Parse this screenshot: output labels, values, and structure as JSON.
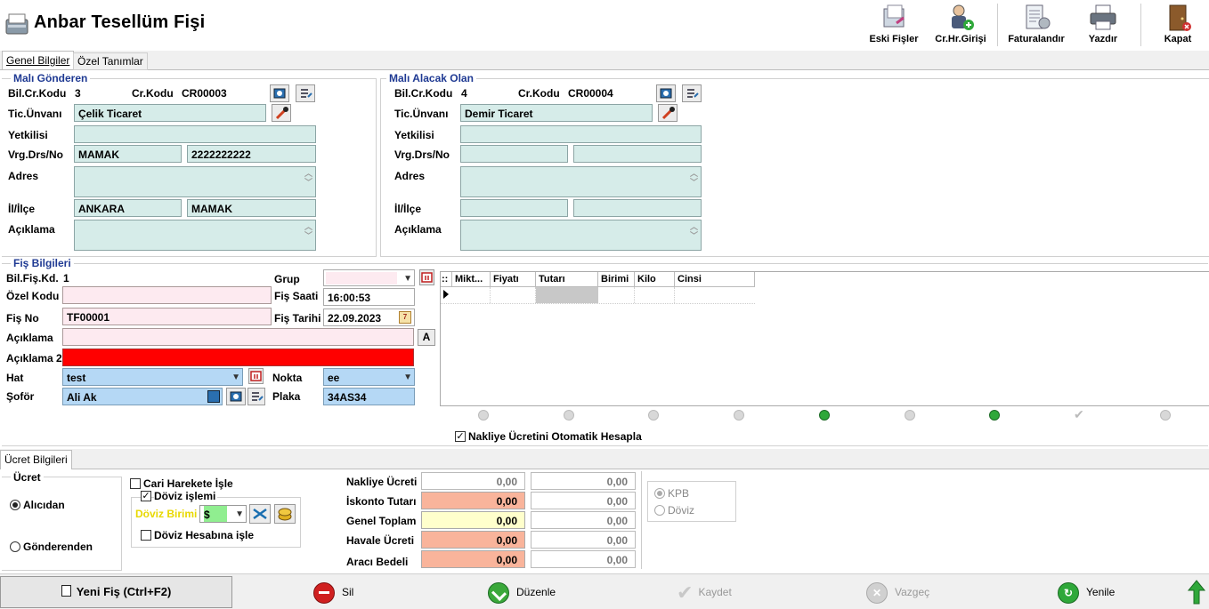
{
  "window": {
    "title": "Anbar Tesellüm Fişi"
  },
  "toolbar": {
    "eski_fisler": "Eski Fişler",
    "cr_hr_girisi": "Cr.Hr.Girişi",
    "faturalandir": "Faturalandır",
    "yazdir": "Yazdır",
    "kapat": "Kapat"
  },
  "tabs": {
    "genel": "Genel Bilgiler",
    "ozel": "Özel Tanımlar"
  },
  "sender": {
    "group_title": "Malı Gönderen",
    "bil_cr_kodu_label": "Bil.Cr.Kodu",
    "bil_cr_kodu": "3",
    "cr_kodu_label": "Cr.Kodu",
    "cr_kodu": "CR00003",
    "tic_unvani_label": "Tic.Ünvanı",
    "tic_unvani": "Çelik Ticaret",
    "yetkilisi_label": "Yetkilisi",
    "yetkilisi": "",
    "vrg_label": "Vrg.Drs/No",
    "vergi_dairesi": "MAMAK",
    "vergi_no": "2222222222",
    "adres_label": "Adres",
    "adres": "",
    "il_ilce_label": "İl/İlçe",
    "il": "ANKARA",
    "ilce": "MAMAK",
    "aciklama_label": "Açıklama",
    "aciklama": ""
  },
  "receiver": {
    "group_title": "Malı Alacak Olan",
    "bil_cr_kodu_label": "Bil.Cr.Kodu",
    "bil_cr_kodu": "4",
    "cr_kodu_label": "Cr.Kodu",
    "cr_kodu": "CR00004",
    "tic_unvani_label": "Tic.Ünvanı",
    "tic_unvani": "Demir Ticaret",
    "yetkilisi_label": "Yetkilisi",
    "yetkilisi": "",
    "vrg_label": "Vrg.Drs/No",
    "vergi_dairesi": "",
    "vergi_no": "",
    "adres_label": "Adres",
    "adres": "",
    "il_ilce_label": "İl/İlçe",
    "il": "",
    "ilce": "",
    "aciklama_label": "Açıklama",
    "aciklama": ""
  },
  "fis": {
    "group_title": "Fiş Bilgileri",
    "bil_fis_kd_label": "Bil.Fiş.Kd.",
    "bil_fis_kd": "1",
    "grup_label": "Grup",
    "grup": "",
    "ozel_kodu_label": "Özel Kodu",
    "ozel_kodu": "",
    "fis_saati_label": "Fiş Saati",
    "fis_saati": "16:00:53",
    "fis_no_label": "Fiş No",
    "fis_no": "TF00001",
    "fis_tarihi_label": "Fiş Tarihi",
    "fis_tarihi": "22.09.2023",
    "aciklama_label": "Açıklama",
    "aciklama": "",
    "aciklama2_label": "Açıklama 2",
    "aciklama2": "",
    "a_button": "A",
    "hat_label": "Hat",
    "hat": "test",
    "nokta_label": "Nokta",
    "nokta": "ee",
    "sofor_label": "Şoför",
    "sofor": "Ali Ak",
    "plaka_label": "Plaka",
    "plaka": "34AS34"
  },
  "grid": {
    "columns": [
      "::",
      "Mikt...",
      "Fiyatı",
      "Tutarı",
      "Birimi",
      "Kilo",
      "Cinsi"
    ],
    "nakliye_auto_label": "Nakliye Ücretini Otomatik Hesapla",
    "nakliye_auto_checked": true
  },
  "ucret_tab": "Ücret Bilgileri",
  "ucret": {
    "group_title": "Ücret",
    "alicidan": "Alıcıdan",
    "gonderenden": "Gönderenden",
    "selected": "Alıcıdan"
  },
  "options": {
    "cari_hareket_label": "Cari Harekete İşle",
    "cari_hareket_checked": false,
    "doviz_islemi_label": "Döviz işlemi",
    "doviz_islemi_checked": true,
    "doviz_birimi_label": "Döviz Birimi",
    "doviz_birimi": "$",
    "doviz_hesabina_label": "Döviz Hesabına işle",
    "doviz_hesabina_checked": false
  },
  "totals": {
    "nakliye_label": "Nakliye Ücreti",
    "nakliye": "0,00",
    "nakliye_doviz": "0,00",
    "iskonto_label": "İskonto Tutarı",
    "iskonto": "0,00",
    "iskonto_doviz": "0,00",
    "genel_label": "Genel Toplam",
    "genel": "0,00",
    "genel_doviz": "0,00",
    "havale_label": "Havale Ücreti",
    "havale": "0,00",
    "havale_doviz": "0,00",
    "araci_label": "Aracı Bedeli",
    "araci": "0,00",
    "araci_doviz": "0,00"
  },
  "currency_mode": {
    "kpb": "KPB",
    "doviz": "Döviz",
    "selected": "KPB"
  },
  "bottom": {
    "yeni_fis": "Yeni Fiş (Ctrl+F2)",
    "sil": "Sil",
    "duzenle": "Düzenle",
    "kaydet": "Kaydet",
    "vazgec": "Vazgeç",
    "yenile": "Yenile"
  },
  "colors": {
    "field_bg": "#d6ece9",
    "pink_bg": "#fdeaf0",
    "red_bg": "#ff0000",
    "blue_bg": "#b5d8f5",
    "title_blue": "#1f3a93"
  }
}
